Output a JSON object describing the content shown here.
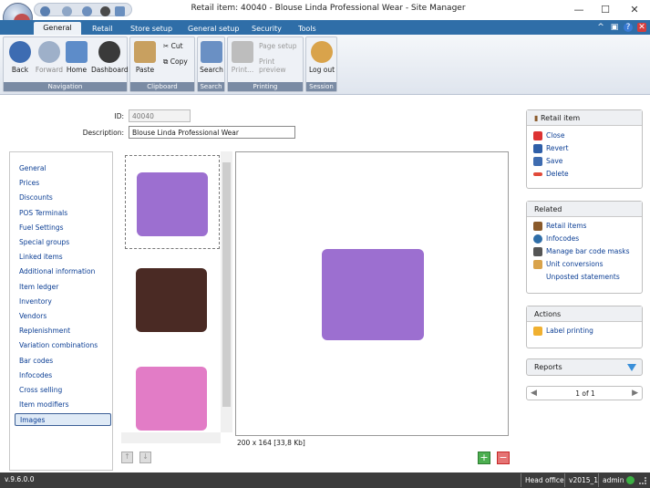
{
  "window": {
    "title": "Retail item: 40040 - Blouse Linda Professional Wear - Site Manager",
    "minimize": "—",
    "maximize": "☐",
    "close": "✕"
  },
  "tabs": [
    "General",
    "Retail",
    "Store setup",
    "General setup",
    "Security",
    "Tools"
  ],
  "ribbon": {
    "navigation": {
      "label": "Navigation",
      "back": "Back",
      "forward": "Forward",
      "home": "Home",
      "dashboard": "Dashboard"
    },
    "clipboard": {
      "label": "Clipboard",
      "paste": "Paste",
      "cut": "Cut",
      "copy": "Copy"
    },
    "search": {
      "label": "Search",
      "search": "Search"
    },
    "printing": {
      "label": "Printing",
      "print": "Print...",
      "page_setup": "Page setup",
      "print_preview": "Print preview"
    },
    "session": {
      "label": "Session",
      "logout": "Log out"
    }
  },
  "form": {
    "id_label": "ID:",
    "id_value": "40040",
    "desc_label": "Description:",
    "desc_value": "Blouse Linda Professional Wear"
  },
  "nav": [
    "General",
    "Prices",
    "Discounts",
    "POS Terminals",
    "Fuel Settings",
    "Special groups",
    "Linked items",
    "Additional information",
    "Item ledger",
    "Inventory",
    "Vendors",
    "Replenishment",
    "Variation combinations",
    "Bar codes",
    "Infocodes",
    "Cross selling",
    "Item modifiers",
    "Images"
  ],
  "image_info": "200 x 164 [33,8 Kb]",
  "panels": {
    "retail_item": {
      "title": "Retail item",
      "items": [
        "Close",
        "Revert",
        "Save",
        "Delete"
      ]
    },
    "related": {
      "title": "Related",
      "items": [
        "Retail items",
        "Infocodes",
        "Manage bar code masks",
        "Unit conversions",
        "Unposted statements"
      ]
    },
    "actions": {
      "title": "Actions",
      "items": [
        "Label printing"
      ]
    },
    "reports": {
      "title": "Reports"
    },
    "pager": "1 of 1"
  },
  "status": {
    "version": "v.9.6.0.0",
    "context": "Head office",
    "db": "v2015_1",
    "user": "admin"
  },
  "colors": {
    "accent": "#2f6ea8",
    "link": "#0b3e94",
    "thumb1": "#9c6fd0",
    "thumb2": "#4a2a24",
    "thumb3": "#e27cc6"
  }
}
